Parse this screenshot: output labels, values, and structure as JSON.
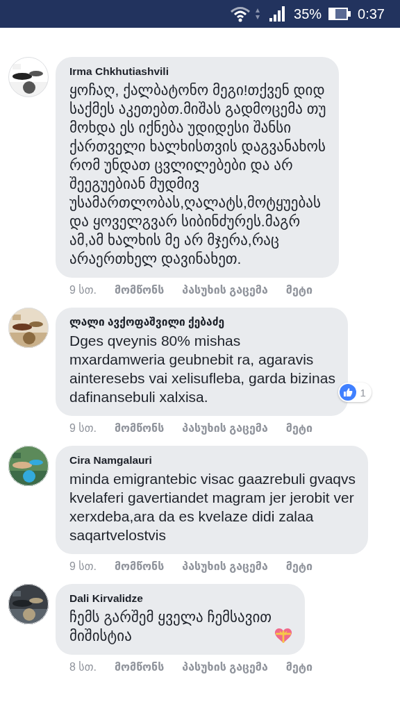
{
  "status_bar": {
    "battery": "35%",
    "time": "0:37"
  },
  "comments": [
    {
      "author": "Irma Chkhutiashvili",
      "text": "ყოჩაღ, ქალბატონო მეგი!თქვენ დიდ\nსაქმეს აკეთებთ.მიშას გადმოცემა თუ\nმოხდა ეს იქნება უდიდესი შანსი\nქართველი ხალხისთვის დაგვანახოს\nრომ უნდათ ცვლილებები და არ\nშეეგუებიან მუდმივ\nუსამართლობას,ღალატს,მოტყუებას\nდა ყოველგვარ სიბინძურეს.მაგრ\nამ,ამ ხალხის მე არ მჯერა,რაც\nარაერთხელ დავინახეთ.",
      "time": "9 სთ.",
      "actions": [
        "მომწონს",
        "პასუხის გაცემა",
        "მეტი"
      ]
    },
    {
      "author": "ლალი ავქოფაშვილი ქებაძე",
      "text": "Dges qveynis 80% mishas\nmxardamweria geubnebit ra, agaravis\nainteresebs vai xelisufleba, garda bizinas\ndafinansebuli xalxisa.",
      "reactions": "1",
      "time": "9 სთ.",
      "actions": [
        "მომწონს",
        "პასუხის გაცემა",
        "მეტი"
      ]
    },
    {
      "author": "Cira Namgalauri",
      "text": "minda emigrantebic visac gaazrebuli gvaqvs\nkvelaferi gavertiandet magram jer jerobit ver\nxerxdeba,ara da es kvelaze didi zalaa\nsaqartvelostvis",
      "time": "9 სთ.",
      "actions": [
        "მომწონს",
        "პასუხის გაცემა",
        "მეტი"
      ]
    },
    {
      "author": "Dali Kirvalidze",
      "text": "ჩემს გარშემ ყველა ჩემსავით\nმიშისტია",
      "emoji": true,
      "time": "8 სთ.",
      "actions": [
        "მომწონს",
        "პასუხის გაცემა",
        "მეტი"
      ]
    }
  ]
}
